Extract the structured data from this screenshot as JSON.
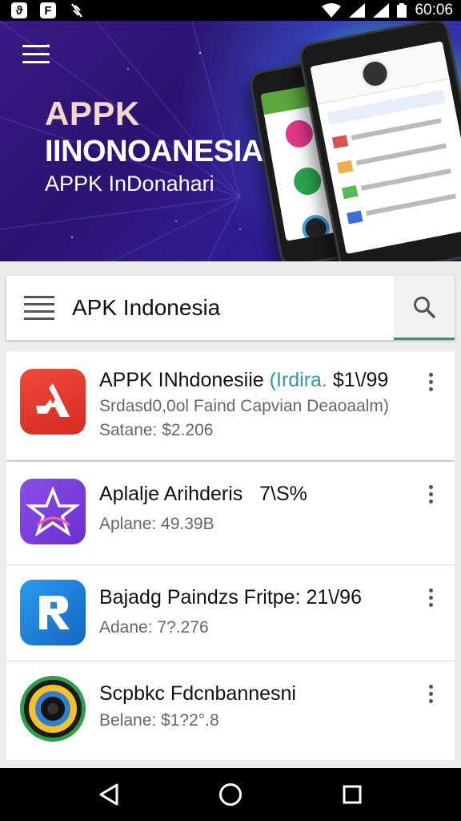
{
  "status_bar": {
    "time": "60:06",
    "left_icons": [
      "app-icon-a",
      "app-icon-f",
      "signal-off-icon"
    ],
    "right_icons": [
      "wifi-icon",
      "cell-signal-icon",
      "cell-signal-icon",
      "battery-icon"
    ]
  },
  "hero": {
    "title_line1": "APPK",
    "title_line2": "IINONOANESIA",
    "subtitle": "APPK InDonahari",
    "colors": {
      "background": "#2b1370",
      "glow": "#3cdcb4"
    }
  },
  "search": {
    "query": "APK Indonesia",
    "accent_color": "#1e9a7a"
  },
  "apps": [
    {
      "title": "APPK INhdonesiie",
      "title_accent": "(Irdira.",
      "title_suffix": "$1\\/99",
      "subtitle": "Srdasd0,0ol Faind Capvian Deaoaalm)",
      "price": "Satane: $2.206",
      "icon": "red-arrow-icon",
      "icon_color": "#e33a2c"
    },
    {
      "title": "Aplalje Arihderis",
      "title_suffix": "7\\S%",
      "subtitle": "",
      "price": "Aplane: 49.39B",
      "icon": "purple-star-icon",
      "icon_color": "#7a3fe0"
    },
    {
      "title": "Bajadg Paindzs Fritpe: 21\\/96",
      "subtitle": "",
      "price": "Adane: 7?.276",
      "icon": "blue-r-icon",
      "icon_color": "#1e88e5"
    },
    {
      "title": "Scpbkc Fdcnbannesni",
      "subtitle": "",
      "price": "Belane: $1?2°.8",
      "icon": "camera-lens-icon",
      "icon_color": "#2e9e4a"
    }
  ],
  "nav_bar": {
    "icons": [
      "back-icon",
      "home-icon",
      "recents-icon"
    ]
  }
}
